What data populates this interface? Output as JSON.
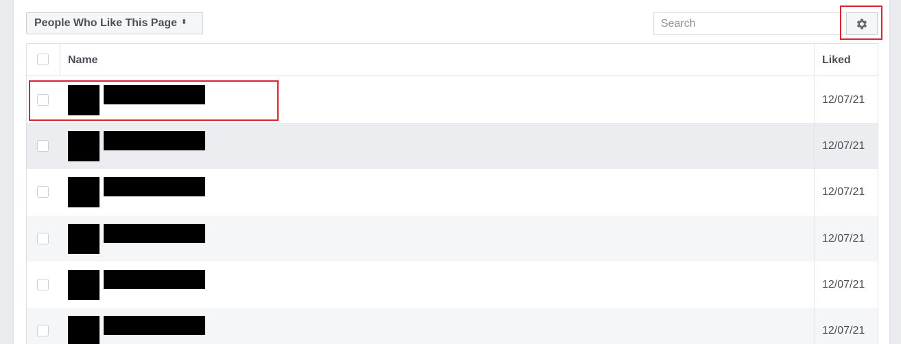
{
  "toolbar": {
    "filter_label": "People Who Like This Page",
    "filter_caret": "⬍",
    "search_placeholder": "Search"
  },
  "table": {
    "columns": [
      "Name",
      "Liked"
    ],
    "rows": [
      {
        "liked": "12/07/21"
      },
      {
        "liked": "12/07/21"
      },
      {
        "liked": "12/07/21"
      },
      {
        "liked": "12/07/21"
      },
      {
        "liked": "12/07/21"
      },
      {
        "liked": "12/07/21"
      }
    ]
  },
  "icons": {
    "settings": "gear-icon",
    "filter_caret": "sort-caret-icon"
  },
  "colors": {
    "highlight": "#d6262f",
    "header_text": "#4b4f56",
    "row_alt": "#ebedf0"
  }
}
